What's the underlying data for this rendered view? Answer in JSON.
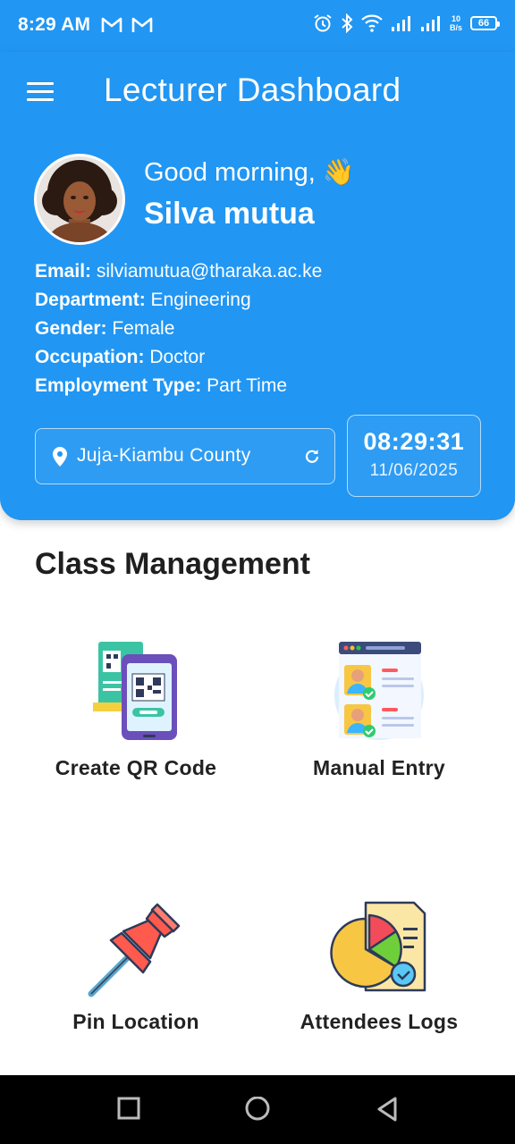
{
  "status_bar": {
    "time": "8:29 AM",
    "net_speed_value": "10",
    "net_speed_unit": "B/s",
    "battery": "66"
  },
  "header": {
    "title": "Lecturer Dashboard",
    "greeting": "Good morning, 👋",
    "user_name": "Silva mutua",
    "info": [
      {
        "label": "Email:",
        "value": "silviamutua@tharaka.ac.ke"
      },
      {
        "label": "Department:",
        "value": "Engineering"
      },
      {
        "label": "Gender:",
        "value": "Female"
      },
      {
        "label": "Occupation:",
        "value": "Doctor"
      },
      {
        "label": "Employment Type:",
        "value": "Part Time"
      }
    ],
    "location": "Juja-Kiambu County",
    "clock_time": "08:29:31",
    "clock_date": "11/06/2025"
  },
  "main": {
    "section_title": "Class Management",
    "tiles": [
      {
        "label": "Create QR Code",
        "icon": "qr-code-phone-icon"
      },
      {
        "label": "Manual Entry",
        "icon": "manual-entry-icon"
      },
      {
        "label": "Pin Location",
        "icon": "pushpin-icon"
      },
      {
        "label": "Attendees Logs",
        "icon": "report-chart-icon"
      }
    ]
  },
  "colors": {
    "primary": "#2196f3",
    "text_dark": "#222222",
    "nav_bar": "#000000"
  }
}
